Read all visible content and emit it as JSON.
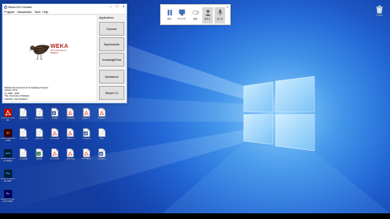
{
  "colors": {
    "wallpaper_deep": "#123c9f",
    "wallpaper_mid": "#2267d6",
    "wallpaper_light": "#63b6f5",
    "window_border": "#4a78c8",
    "weka_red": "#b3261e",
    "taskbar": "#000000"
  },
  "weka": {
    "title": "Weka GUI Chooser",
    "controls": [
      "—",
      "☐",
      "✕"
    ],
    "menu": [
      "Program",
      "Visualization",
      "Tools",
      "Help"
    ],
    "logo_word": "WEKA",
    "logo_subtitle": "The University of Waikato",
    "info_lines": [
      "Waikato Environment for Knowledge Analysis",
      "Version 3.8.5",
      "(c) 1999 - 2020",
      "The University of Waikato",
      "Hamilton, New Zealand"
    ],
    "applications_label": "Applications",
    "buttons": [
      "Explorer",
      "Experimenter",
      "KnowledgeFlow",
      "Workbench",
      "Simple CLI"
    ]
  },
  "recorder": {
    "items": [
      {
        "label": "暂停",
        "icon": "pause-icon"
      },
      {
        "label": "00:01:22",
        "icon": "screen-icon"
      },
      {
        "label": "截图",
        "icon": "camera-icon"
      },
      {
        "label": "摄像头",
        "icon": "webcam-icon"
      },
      {
        "label": "麦克风",
        "icon": "microphone-icon"
      }
    ],
    "close": "✕"
  },
  "desktop": {
    "recycle_bin": {
      "label": "回收站",
      "icon": "recycle-bin-icon"
    },
    "icon_columns": [
      [
        {
          "label": "Adobe Acrobat DC",
          "icon": "acrobat-icon"
        },
        {
          "label": "Adobe Illustrator 2021",
          "icon": "illustrator-icon",
          "badge": "Ai"
        },
        {
          "label": "Adobe Lightroom Classic",
          "icon": "lightroom-icon",
          "badge": "Lrc"
        },
        {
          "label": "Adobe Photoshop 2021",
          "icon": "photoshop-icon",
          "badge": "Ps"
        },
        {
          "label": "Adobe Premiere Pro 2021",
          "icon": "premiere-icon",
          "badge": "Pr"
        }
      ],
      [
        {
          "label": "新建文档",
          "icon": "doc-icon"
        },
        {
          "label": "论文初稿",
          "icon": "doc-icon"
        },
        {
          "label": "实验数据",
          "icon": "doc-icon"
        }
      ],
      [
        {
          "label": "数据说明",
          "icon": "doc-icon"
        },
        {
          "label": "实验记录",
          "icon": "doc-icon"
        },
        {
          "label": "数据集",
          "icon": "spreadsheet-icon"
        }
      ],
      [
        {
          "label": "开题报告",
          "icon": "word-icon"
        },
        {
          "label": "参考文献1",
          "icon": "pdf-icon"
        },
        {
          "label": "参考文献2",
          "icon": "pdf-icon"
        }
      ],
      [
        {
          "label": "文献综述",
          "icon": "pdf-icon"
        },
        {
          "label": "机器学习",
          "icon": "pdf-icon"
        },
        {
          "label": "数据挖掘",
          "icon": "pdf-icon"
        }
      ],
      [
        {
          "label": "课程讲义",
          "icon": "pdf-icon"
        },
        {
          "label": "作业要求",
          "icon": "word-icon"
        },
        {
          "label": "Weka教程",
          "icon": "pdf-icon"
        }
      ],
      [
        {
          "label": "实验指导",
          "icon": "pdf-icon"
        },
        {
          "label": "笔记",
          "icon": "doc-icon"
        },
        {
          "label": "实验报告",
          "icon": "word-icon"
        }
      ]
    ]
  }
}
